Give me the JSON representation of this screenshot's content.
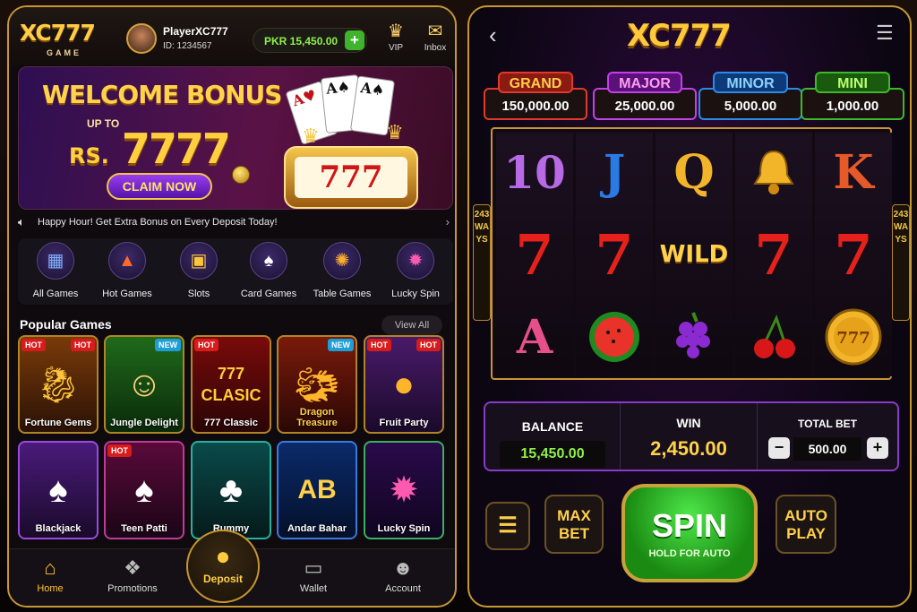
{
  "brand": {
    "logo": "XC777",
    "logo_sub": "GAME"
  },
  "player": {
    "name": "PlayerXC777",
    "id": "ID: 1234567"
  },
  "wallet": {
    "balance": "PKR 15,450.00"
  },
  "header_icons": [
    {
      "label": "VIP",
      "icon": "crown-icon"
    },
    {
      "label": "Inbox",
      "icon": "mail-icon"
    }
  ],
  "banner": {
    "title": "WELCOME BONUS",
    "upto": "UP TO",
    "amount_prefix": "RS.",
    "amount": "7777",
    "cta": "CLAIM NOW",
    "slot_digits": "777"
  },
  "ticker": {
    "text": "Happy Hour! Get Extra Bonus on Every Deposit Today!"
  },
  "categories": [
    {
      "label": "All Games",
      "icon": "grid-icon"
    },
    {
      "label": "Hot Games",
      "icon": "flame-icon"
    },
    {
      "label": "Slots",
      "icon": "slot-machine-icon"
    },
    {
      "label": "Card Games",
      "icon": "cards-icon"
    },
    {
      "label": "Table Games",
      "icon": "roulette-icon"
    },
    {
      "label": "Lucky Spin",
      "icon": "wheel-icon"
    }
  ],
  "popular": {
    "title": "Popular Games",
    "view_all": "View All",
    "games": [
      {
        "name": "Fortune Gems",
        "tags": [
          "HOT",
          "HOT"
        ]
      },
      {
        "name": "Jungle Delight",
        "tags": [
          "NEW"
        ]
      },
      {
        "name": "777 Classic",
        "tags": [
          "HOT"
        ],
        "art": "777 CLASIC"
      },
      {
        "name": "Dragon Treasure",
        "tags": [
          "NEW"
        ]
      },
      {
        "name": "Fruit Party",
        "tags": [
          "HOT",
          "HOT"
        ]
      },
      {
        "name": "Blackjack",
        "tags": []
      },
      {
        "name": "Teen Patti",
        "tags": [
          "HOT"
        ]
      },
      {
        "name": "Rummy",
        "tags": []
      },
      {
        "name": "Andar Bahar",
        "tags": [],
        "art": "AB"
      },
      {
        "name": "Lucky Spin",
        "tags": []
      }
    ]
  },
  "bottom_nav": [
    {
      "label": "Home",
      "icon": "home-icon",
      "active": true
    },
    {
      "label": "Promotions",
      "icon": "gift-icon"
    },
    {
      "label": "Deposit",
      "icon": "coins-icon"
    },
    {
      "label": "Wallet",
      "icon": "wallet-icon"
    },
    {
      "label": "Account",
      "icon": "user-icon"
    }
  ],
  "game": {
    "title": "XC777",
    "jackpots": [
      {
        "label": "GRAND",
        "value": "150,000.00",
        "color": "#e23a2a"
      },
      {
        "label": "MAJOR",
        "value": "25,000.00",
        "color": "#c340e6"
      },
      {
        "label": "MINOR",
        "value": "5,000.00",
        "color": "#2a8ce6"
      },
      {
        "label": "MINI",
        "value": "1,000.00",
        "color": "#3fb82a"
      }
    ],
    "ways": "243 WAYS",
    "reels": [
      [
        "10",
        "7",
        "A"
      ],
      [
        "J",
        "7",
        "watermelon"
      ],
      [
        "Q",
        "WILD",
        "grapes"
      ],
      [
        "bell",
        "7",
        "cherries"
      ],
      [
        "K",
        "7",
        "777 coin"
      ]
    ],
    "balance_label": "BALANCE",
    "balance": "15,450.00",
    "win_label": "WIN",
    "win": "2,450.00",
    "bet_label": "TOTAL BET",
    "bet": "500.00",
    "max_bet": [
      "MAX",
      "BET"
    ],
    "spin": "SPIN",
    "spin_sub": "HOLD FOR AUTO",
    "auto_play": [
      "AUTO",
      "PLAY"
    ]
  }
}
